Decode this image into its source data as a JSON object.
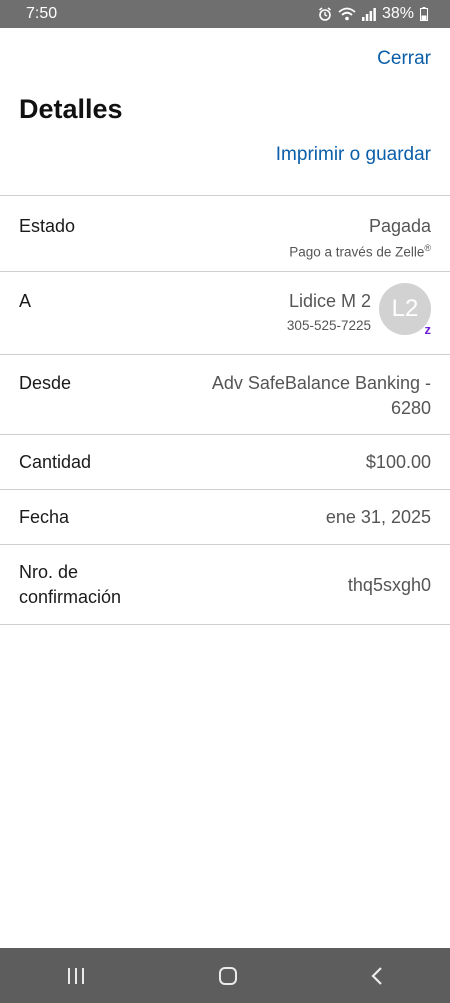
{
  "status_bar": {
    "time": "7:50",
    "battery": "38%",
    "icons": [
      "alarm-icon",
      "wifi-icon",
      "signal-icon",
      "battery-icon"
    ]
  },
  "header": {
    "close_label": "Cerrar",
    "title": "Detalles",
    "print_label": "Imprimir o guardar"
  },
  "details": {
    "status": {
      "label": "Estado",
      "value": "Pagada",
      "sub": "Pago a través de Zelle",
      "sub_mark": "®"
    },
    "to": {
      "label": "A",
      "name": "Lidice M 2",
      "phone": "305-525-7225",
      "avatar_initials": "L2",
      "badge": "z"
    },
    "from": {
      "label": "Desde",
      "value_line1": "Adv SafeBalance Banking -",
      "value_line2": "6280"
    },
    "amount": {
      "label": "Cantidad",
      "value": "$100.00"
    },
    "date": {
      "label": "Fecha",
      "value": "ene 31, 2025"
    },
    "confirmation": {
      "label_line1": "Nro. de",
      "label_line2": "confirmación",
      "value": "thq5sxgh0"
    }
  },
  "nav_bar": {
    "icons": [
      "recent-apps-icon",
      "home-icon",
      "back-icon"
    ]
  },
  "colors": {
    "link": "#0b5ea8",
    "zelle": "#6d1ed4",
    "status_bar": "#6f6f6f",
    "nav_bar": "#5d5d5d"
  }
}
